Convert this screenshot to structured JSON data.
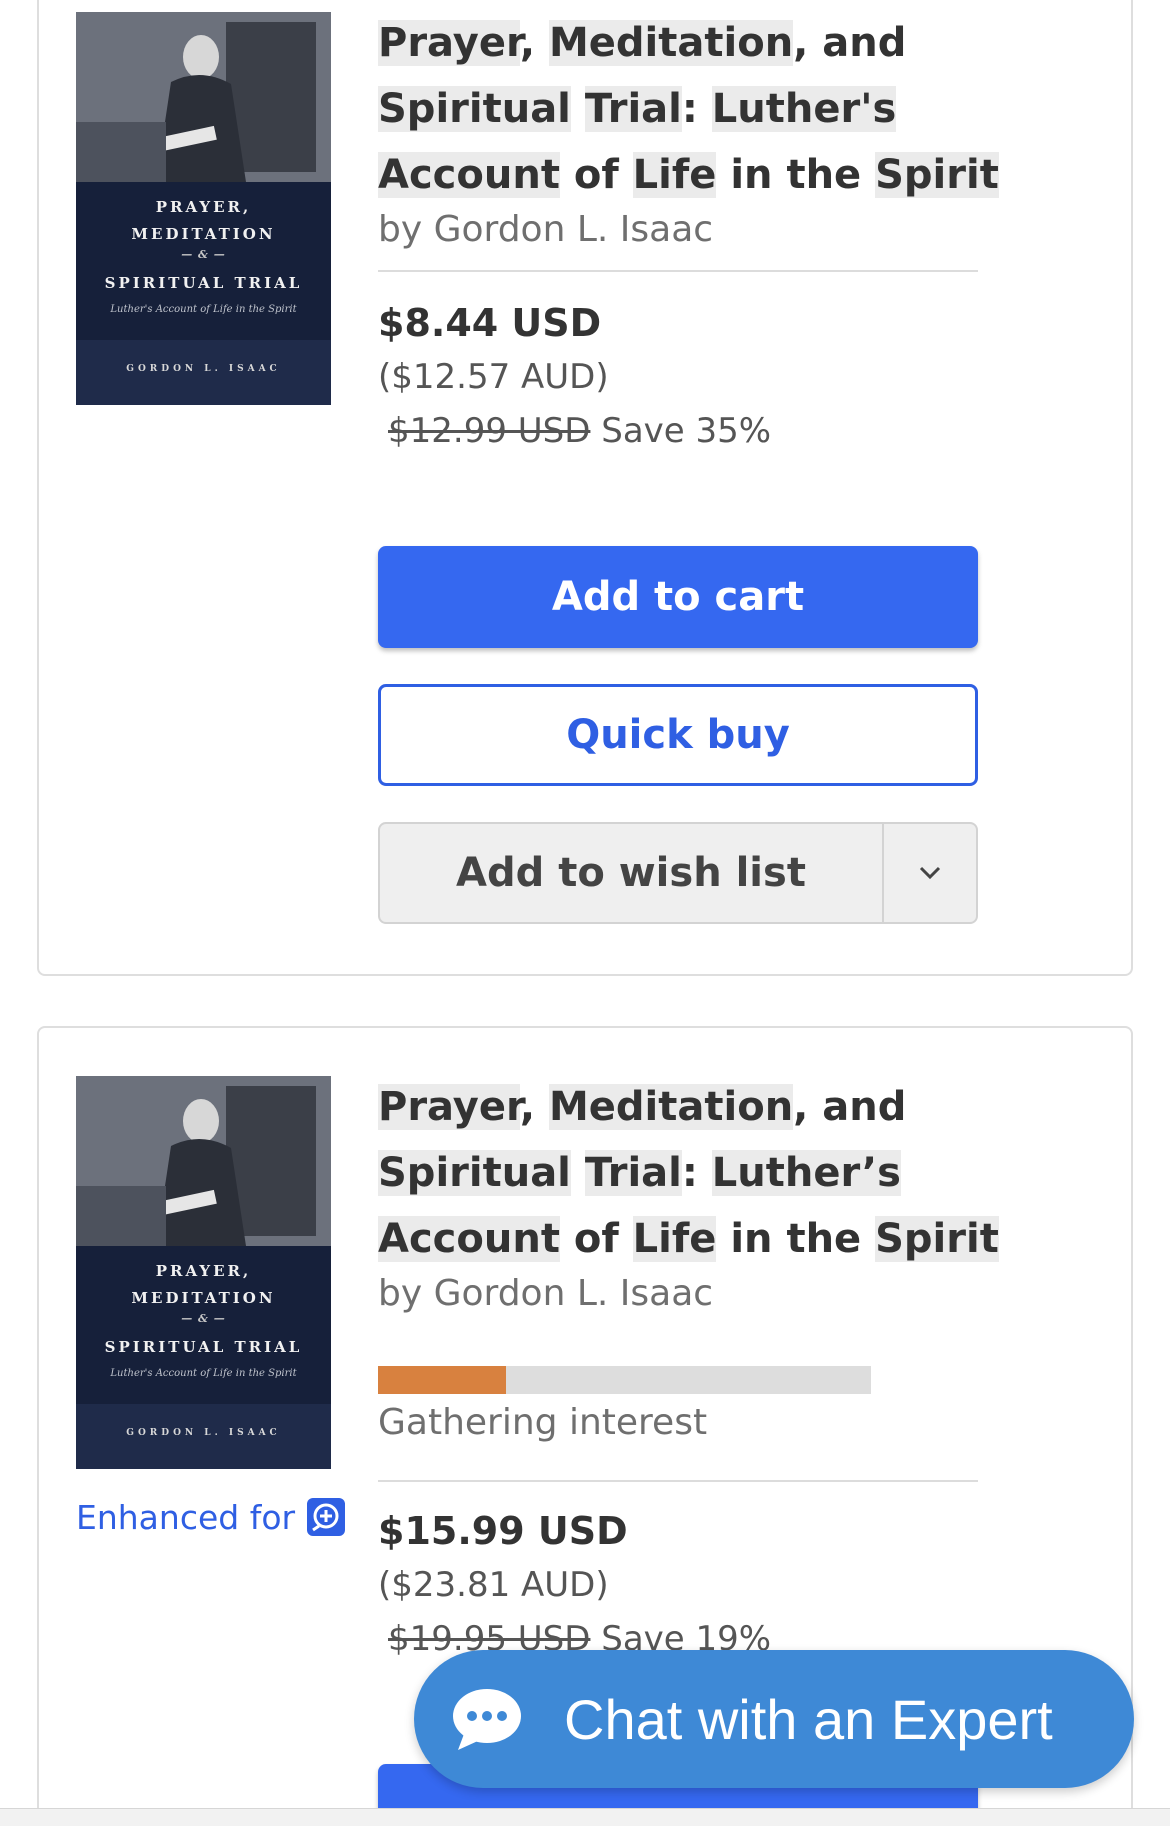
{
  "products": [
    {
      "cover": {
        "title_line1": "PRAYER,",
        "title_line2": "MEDITATION",
        "title_amp": "— & —",
        "title_line3": "SPIRITUAL TRIAL",
        "subtitle": "Luther's Account of Life in the Spirit",
        "author": "GORDON L. ISAAC"
      },
      "title_parts": [
        "Prayer",
        ", ",
        "Meditation",
        ", and ",
        "Spiritual",
        " ",
        "Trial",
        ": ",
        "Luther's",
        " ",
        "Account",
        " of ",
        "Life",
        " in the ",
        "Spirit"
      ],
      "byline": "by Gordon L. Isaac",
      "price": "$8.44 USD",
      "price_aud": "($12.57 AUD)",
      "original_price": "$12.99 USD",
      "save": "Save 35%",
      "buttons": {
        "add_to_cart": "Add to cart",
        "quick_buy": "Quick buy",
        "add_to_wish_list": "Add to wish list"
      }
    },
    {
      "cover": {
        "title_line1": "PRAYER,",
        "title_line2": "MEDITATION",
        "title_amp": "— & —",
        "title_line3": "SPIRITUAL TRIAL",
        "subtitle": "Luther's Account of Life in the Spirit",
        "author": "GORDON L. ISAAC"
      },
      "title_parts": [
        "Prayer",
        ", ",
        "Meditation",
        ", and ",
        "Spiritual",
        " ",
        "Trial",
        ": ",
        "Luther’s",
        " ",
        "Account",
        " of ",
        "Life",
        " in the ",
        "Spirit"
      ],
      "byline": "by Gordon L. Isaac",
      "interest_progress": 0.26,
      "interest_label": "Gathering interest",
      "enhanced_label": "Enhanced for",
      "price": "$15.99 USD",
      "price_aud": "($23.81 AUD)",
      "original_price": "$19.95 USD",
      "save": "Save 19%"
    }
  ],
  "chat": {
    "label": "Chat with an Expert"
  },
  "colors": {
    "primary": "#3568f0",
    "chat": "#3e89d6",
    "progress": "#d8813f"
  }
}
